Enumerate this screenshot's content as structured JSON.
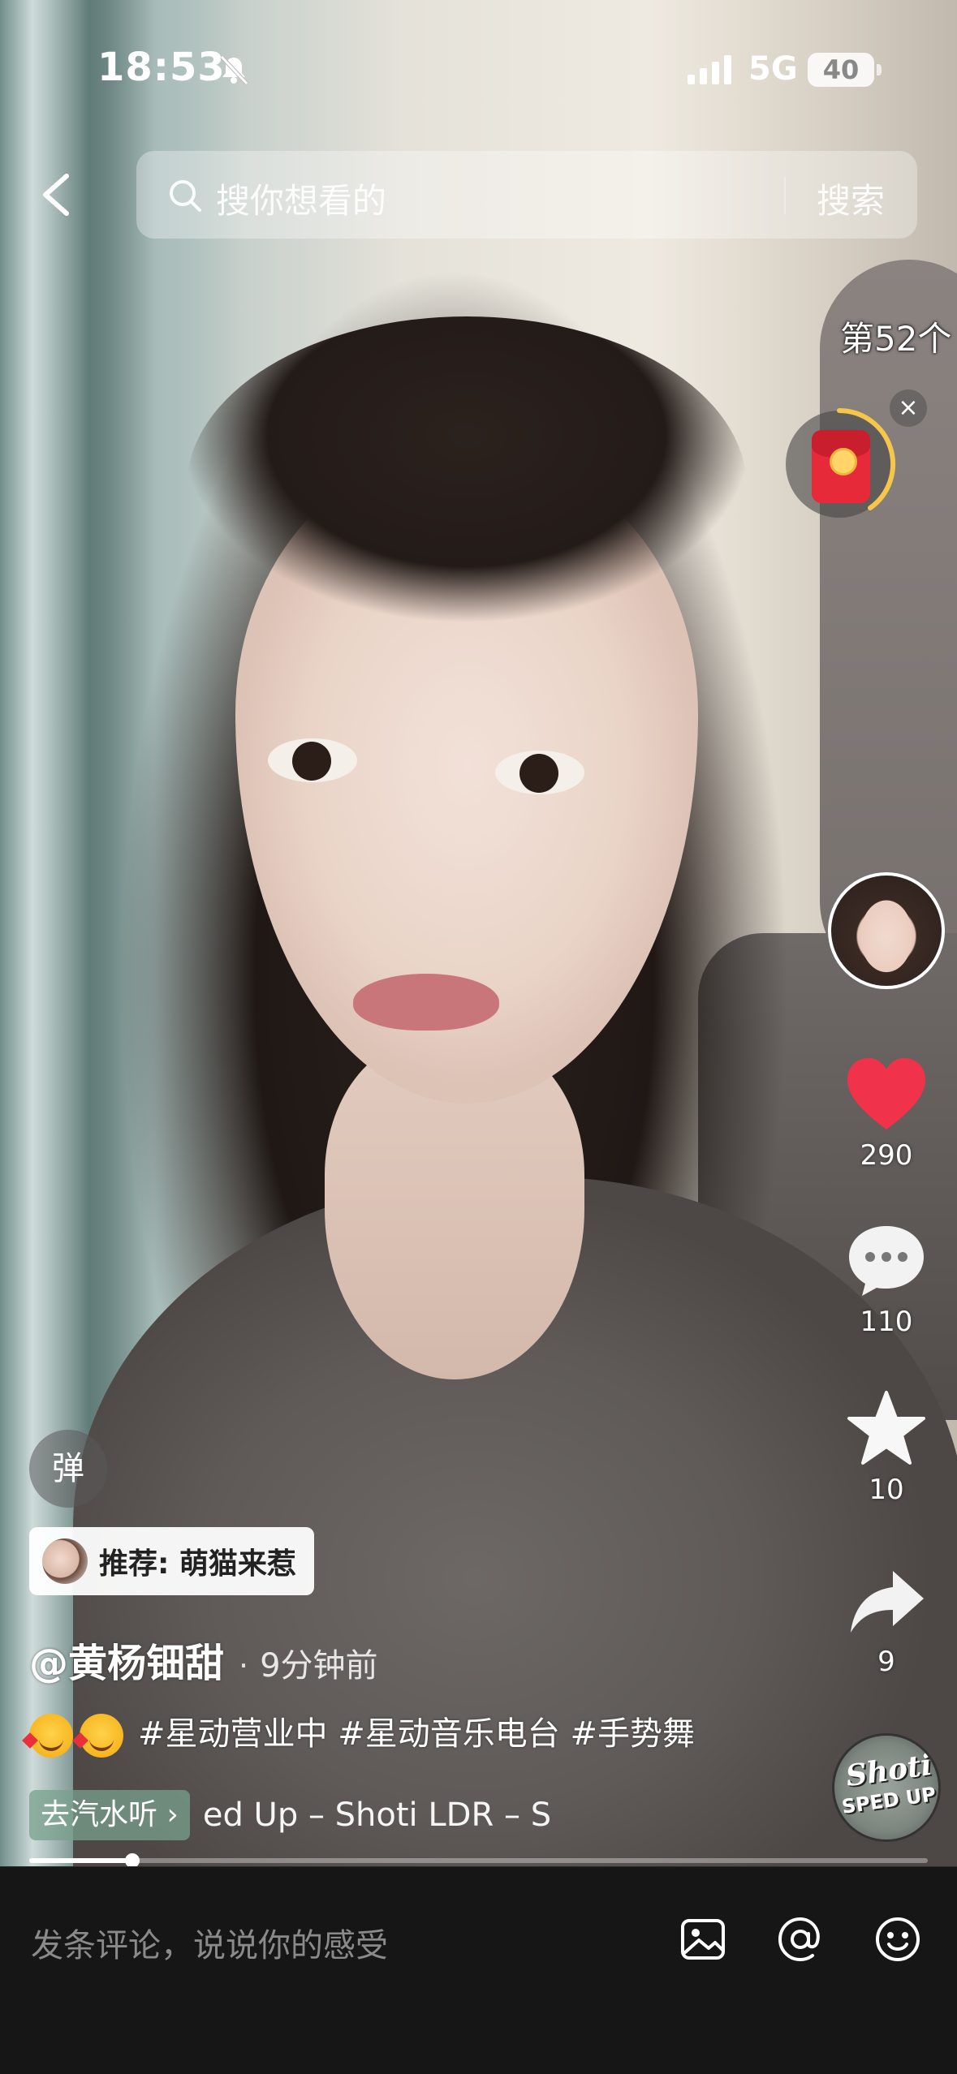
{
  "status_bar": {
    "time": "18:53",
    "network": "5G",
    "battery": "40"
  },
  "search": {
    "placeholder": "搜你想看的",
    "button": "搜索"
  },
  "counter": "第52个",
  "packet": {
    "close": "×"
  },
  "actions": {
    "likes": "290",
    "comments": "110",
    "favorites": "10",
    "shares": "9"
  },
  "danmu_label": "弹",
  "recommend_chip": "推荐: 萌猫来惹",
  "author": "@黄杨钿甜",
  "posted_ago": "9分钟前",
  "description": {
    "hashtags": "#星动营业中 #星动音乐电台 #手势舞"
  },
  "music": {
    "button": "去汽水听 ›",
    "scrolling_title": "ed Up – Shoti    LDR – S",
    "disc_text_1": "Shoti",
    "disc_text_2": "SPED UP"
  },
  "progress": {
    "fraction": 0.115
  },
  "comment_bar": {
    "placeholder": "发条评论，说说你的感受"
  },
  "colors": {
    "like": "#f0324b",
    "background_bar": "#161616"
  }
}
